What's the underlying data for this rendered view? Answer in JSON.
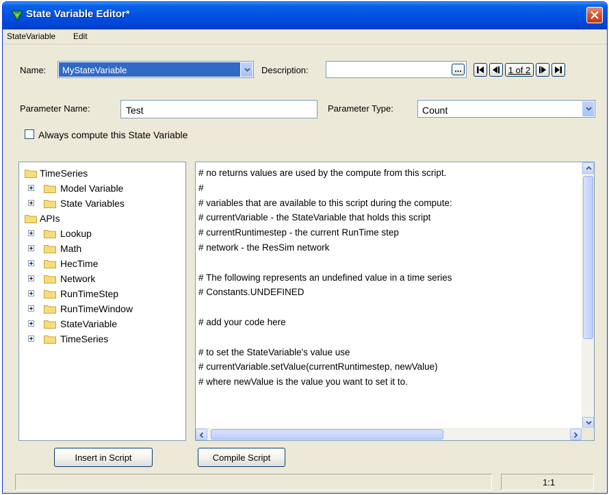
{
  "window": {
    "title": "State Variable Editor*"
  },
  "menu": [
    "StateVariable",
    "Edit"
  ],
  "name_field": {
    "label": "Name:",
    "value": "MyStateVariable"
  },
  "description_field": {
    "label": "Description:",
    "value": ""
  },
  "navigation": {
    "page_text": "1 of 2"
  },
  "parameter_name": {
    "label": "Parameter Name:",
    "value": "Test"
  },
  "parameter_type": {
    "label": "Parameter Type:",
    "value": "Count"
  },
  "always_compute": {
    "label": "Always compute this State Variable",
    "checked": false
  },
  "tree": [
    {
      "label": "TimeSeries",
      "level": 0,
      "expandable": false
    },
    {
      "label": "Model Variable",
      "level": 1,
      "expandable": true
    },
    {
      "label": "State Variables",
      "level": 1,
      "expandable": true
    },
    {
      "label": "APIs",
      "level": 0,
      "expandable": false
    },
    {
      "label": "Lookup",
      "level": 1,
      "expandable": true
    },
    {
      "label": "Math",
      "level": 1,
      "expandable": true
    },
    {
      "label": "HecTime",
      "level": 1,
      "expandable": true
    },
    {
      "label": "Network",
      "level": 1,
      "expandable": true
    },
    {
      "label": "RunTimeStep",
      "level": 1,
      "expandable": true
    },
    {
      "label": "RunTimeWindow",
      "level": 1,
      "expandable": true
    },
    {
      "label": "StateVariable",
      "level": 1,
      "expandable": true
    },
    {
      "label": "TimeSeries",
      "level": 1,
      "expandable": true
    }
  ],
  "script_lines": [
    "# no returns values are used by the compute from this script.",
    "#",
    "# variables that are available to this script during the compute:",
    "# currentVariable - the StateVariable that holds this script",
    "# currentRuntimestep - the current RunTime step",
    "# network - the ResSim network",
    "",
    "# The following represents an undefined value in a time series",
    "# Constants.UNDEFINED",
    "",
    "# add your code here",
    "",
    "# to set the StateVariable's value use",
    "# currentVariable.setValue(currentRuntimestep, newValue)",
    "# where newValue is the value you want to set it to."
  ],
  "buttons": {
    "insert_in_script": "Insert in Script",
    "compile_script": "Compile Script"
  },
  "status": {
    "cursor_position": "1:1"
  },
  "colors": {
    "titlebar": "#0054e3",
    "window_bg": "#ece9d8",
    "selection": "#316ac5",
    "close": "#d6542d"
  }
}
